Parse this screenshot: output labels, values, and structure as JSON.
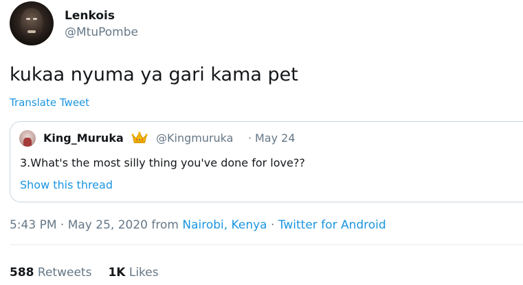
{
  "tweet": {
    "author": {
      "display_name": "Lenkois",
      "handle": "@MtuPombe"
    },
    "text": "kukaa nyuma ya gari kama pet",
    "translate_label": "Translate Tweet",
    "quoted": {
      "display_name": "King_Muruka",
      "badge_icon": "crown-emoji-icon",
      "handle": "@Kingmuruka",
      "separator": "·",
      "date": "May 24",
      "text": "3.What's the most silly thing you've done for love??",
      "thread_link": "Show this thread"
    },
    "meta": {
      "time": "5:43 PM",
      "sep1": " · ",
      "date": "May 25, 2020",
      "from_label": " from ",
      "location": "Nairobi, Kenya",
      "sep2": " · ",
      "source": "Twitter for Android"
    },
    "stats": {
      "retweets_count": "588",
      "retweets_label": "Retweets",
      "likes_count": "1K",
      "likes_label": "Likes"
    }
  },
  "colors": {
    "link": "#1b95e0",
    "secondary_text": "#657786",
    "primary_text": "#14171a",
    "border": "#ccd6dd"
  }
}
